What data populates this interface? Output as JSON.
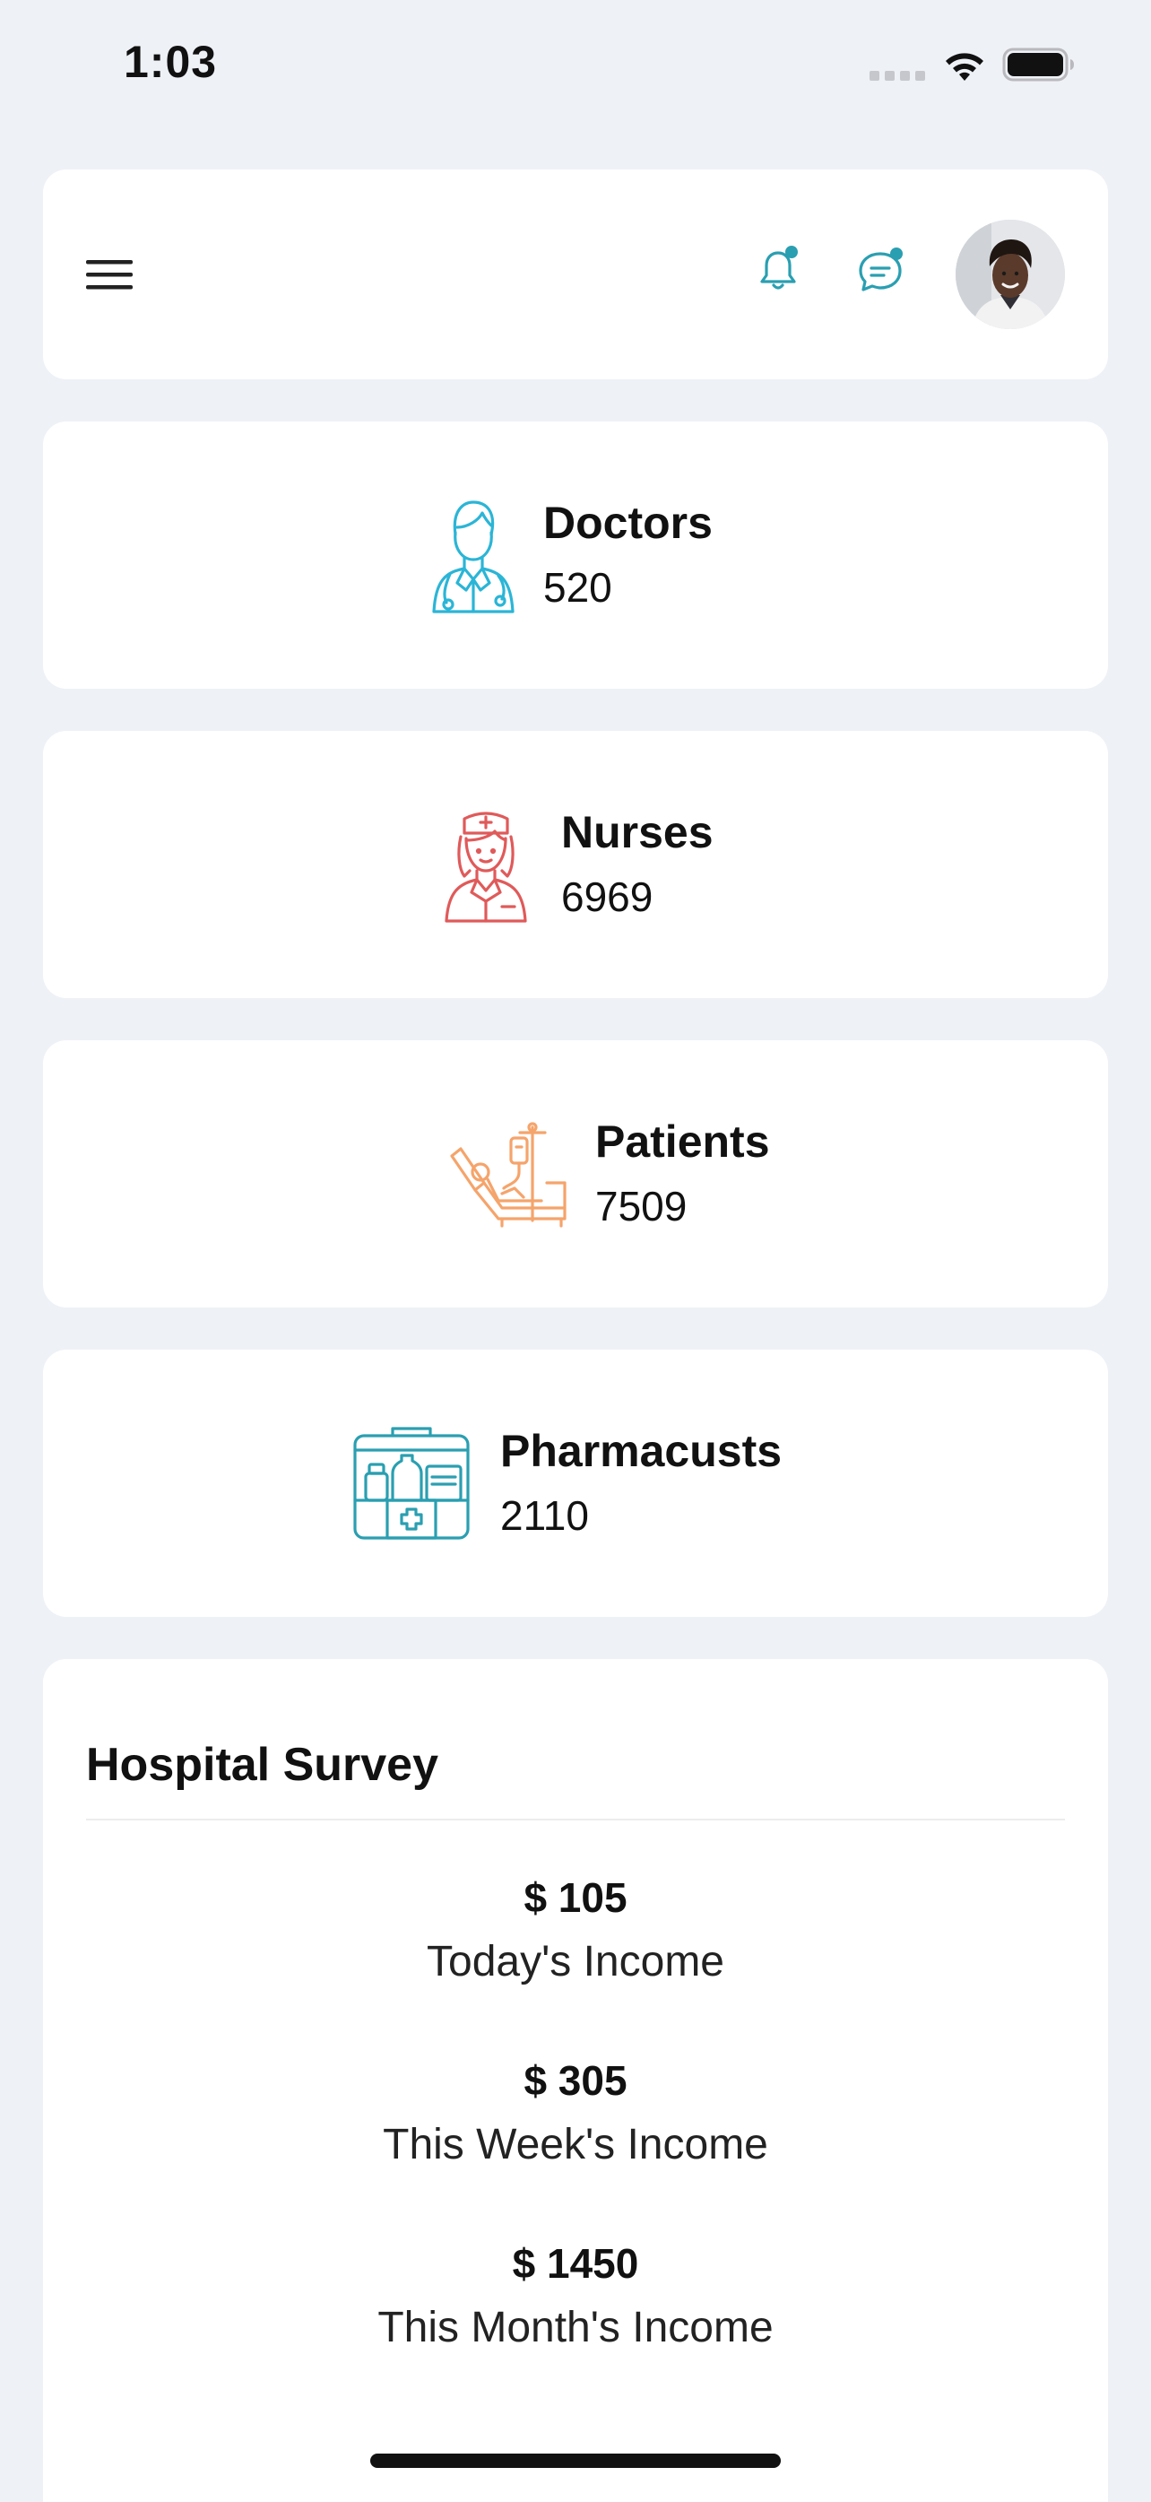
{
  "status_bar": {
    "time": "1:03"
  },
  "header": {
    "menu_icon": "hamburger-menu-icon",
    "notification_icon": "bell-icon",
    "message_icon": "chat-bubble-icon",
    "avatar": "user-avatar",
    "accent_color": "#2a9fb1"
  },
  "stats": [
    {
      "label": "Doctors",
      "value": "520",
      "icon": "doctor-icon",
      "color": "#2bb5d6"
    },
    {
      "label": "Nurses",
      "value": "6969",
      "icon": "nurse-icon",
      "color": "#e05a5a"
    },
    {
      "label": "Patients",
      "value": "7509",
      "icon": "hospital-bed-icon",
      "color": "#f5a46b"
    },
    {
      "label": "Pharmacusts",
      "value": "2110",
      "icon": "medicine-kit-icon",
      "color": "#2a9fb1"
    }
  ],
  "survey": {
    "title": "Hospital Survey",
    "items": [
      {
        "amount": "$ 105",
        "label": "Today's Income"
      },
      {
        "amount": "$ 305",
        "label": "This Week's Income"
      },
      {
        "amount": "$ 1450",
        "label": "This Month's Income"
      }
    ]
  }
}
